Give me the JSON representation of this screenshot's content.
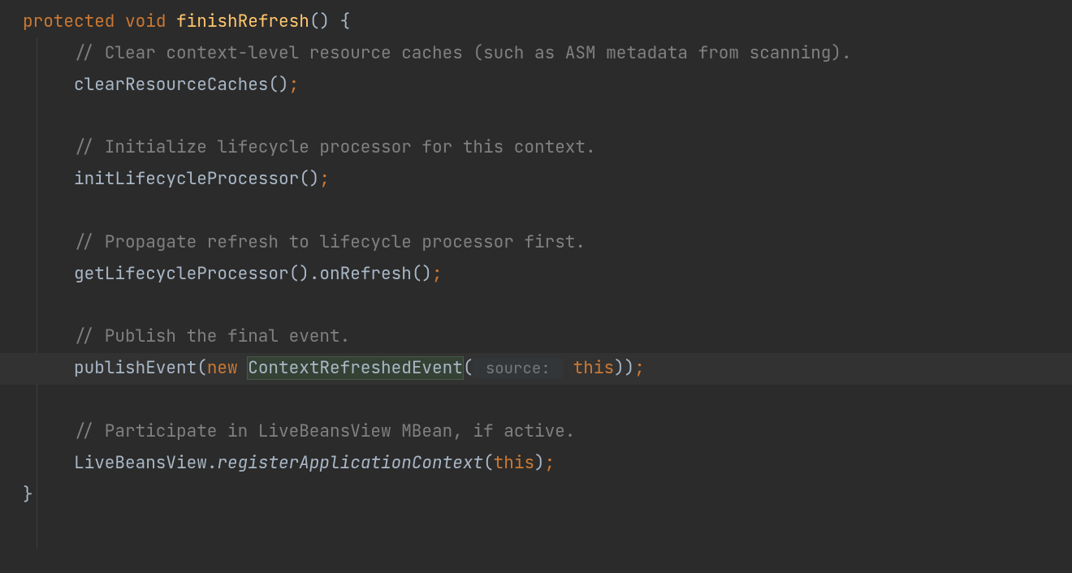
{
  "code": {
    "line1": {
      "keyword_protected": "protected",
      "keyword_void": "void",
      "method_name": "finishRefresh",
      "parens": "()",
      "brace_open": " {"
    },
    "line2": {
      "comment": "// Clear context-level resource caches (such as ASM metadata from scanning)."
    },
    "line3": {
      "method": "clearResourceCaches",
      "parens": "()",
      "semi": ";"
    },
    "line4": {
      "comment": "// Initialize lifecycle processor for this context."
    },
    "line5": {
      "method": "initLifecycleProcessor",
      "parens": "()",
      "semi": ";"
    },
    "line6": {
      "comment": "// Propagate refresh to lifecycle processor first."
    },
    "line7": {
      "method1": "getLifecycleProcessor",
      "parens1": "()",
      "dot": ".",
      "method2": "onRefresh",
      "parens2": "()",
      "semi": ";"
    },
    "line8": {
      "comment": "// Publish the final event."
    },
    "line9": {
      "method": "publishEvent",
      "paren_open": "(",
      "new_kw": "new",
      "class_name": "ContextRefreshedEvent",
      "paren_open2": "(",
      "hint": " source: ",
      "this_kw": "this",
      "paren_close": "))",
      "semi": ";"
    },
    "line10": {
      "comment": "// Participate in LiveBeansView MBean, if active."
    },
    "line11": {
      "class": "LiveBeansView",
      "dot": ".",
      "method": "registerApplicationContext",
      "paren_open": "(",
      "this_kw": "this",
      "paren_close": ")",
      "semi": ";"
    },
    "line12": {
      "brace_close": "}"
    }
  }
}
